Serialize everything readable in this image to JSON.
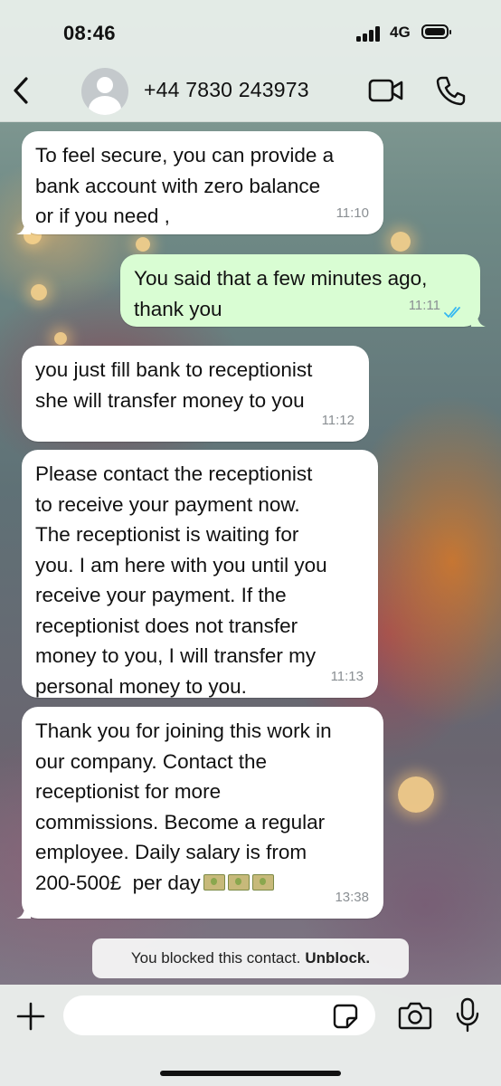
{
  "status_bar": {
    "time": "08:46",
    "network": "4G"
  },
  "header": {
    "contact_name": "+44 7830 243973",
    "icons": [
      "back-chevron-icon",
      "avatar-icon",
      "video-call-icon",
      "phone-icon"
    ]
  },
  "messages": [
    {
      "direction": "in",
      "text": "To feel secure, you can provide a\nbank account with zero balance\nor if you need ,",
      "time": "11:10"
    },
    {
      "direction": "out",
      "text": "You said that a few minutes ago,\nthank you",
      "time": "11:11",
      "status": "read"
    },
    {
      "direction": "in",
      "text": "you just fill bank to receptionist\nshe will transfer money to you",
      "time": "11:12"
    },
    {
      "direction": "in",
      "text": "Please contact the receptionist\nto receive your payment now.\nThe receptionist is waiting for\nyou. I am here with you until you\nreceive your payment. If the\nreceptionist does not transfer\nmoney to you, I will transfer my\npersonal money to you.",
      "time": "11:13"
    },
    {
      "direction": "in",
      "text": "Thank you for joining this work in\nour company. Contact the\nreceptionist for more\ncommissions. Become a regular\nemployee. Daily salary is from\n200-500£  per day",
      "emoji": [
        "money-emoji",
        "money-emoji",
        "money-emoji"
      ],
      "time": "13:38"
    }
  ],
  "system_note": {
    "text": "You blocked this contact.",
    "action": "Unblock."
  },
  "composer": {
    "placeholder": "",
    "value": "",
    "icons": [
      "plus-icon",
      "sticker-icon",
      "camera-icon",
      "mic-icon"
    ]
  },
  "colors": {
    "incoming_bubble": "#ffffff",
    "outgoing_bubble": "#d9fdd3",
    "read_ticks": "#34b7f1",
    "timestamp": "#8a8f93"
  }
}
